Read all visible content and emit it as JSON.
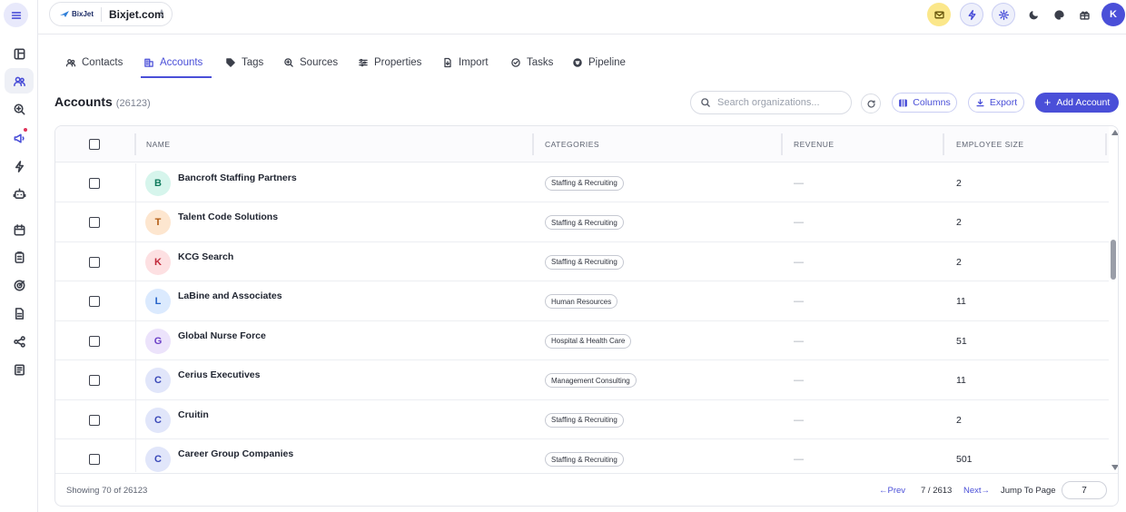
{
  "topbar": {
    "org_logo_text": "BixJet",
    "org_name": "Bixjet.com",
    "avatar_initial": "K"
  },
  "tabs": [
    {
      "label": "Contacts",
      "icon": "users-icon",
      "active": false
    },
    {
      "label": "Accounts",
      "icon": "building-icon",
      "active": true
    },
    {
      "label": "Tags",
      "icon": "tag-icon",
      "active": false
    },
    {
      "label": "Sources",
      "icon": "source-search-icon",
      "active": false
    },
    {
      "label": "Properties",
      "icon": "sliders-icon",
      "active": false
    },
    {
      "label": "Import",
      "icon": "file-import-icon",
      "active": false
    },
    {
      "label": "Tasks",
      "icon": "check-circle-icon",
      "active": false
    },
    {
      "label": "Pipeline",
      "icon": "pipeline-icon",
      "active": false
    }
  ],
  "header": {
    "title": "Accounts",
    "count": "(26123)",
    "search_placeholder": "Search organizations...",
    "columns_label": "Columns",
    "export_label": "Export",
    "add_label": "Add Account"
  },
  "table": {
    "columns": [
      "NAME",
      "CATEGORIES",
      "REVENUE",
      "EMPLOYEE SIZE"
    ],
    "rows": [
      {
        "initial": "B",
        "name": "Bancroft Staffing Partners",
        "category": "Staffing & Recruiting",
        "revenue": "—",
        "employees": "2",
        "avatar_bg": "#d6f5ec",
        "avatar_fg": "#0f7a5c"
      },
      {
        "initial": "T",
        "name": "Talent Code Solutions",
        "category": "Staffing & Recruiting",
        "revenue": "—",
        "employees": "2",
        "avatar_bg": "#fde6cf",
        "avatar_fg": "#b25a10"
      },
      {
        "initial": "K",
        "name": "KCG Search",
        "category": "Staffing & Recruiting",
        "revenue": "—",
        "employees": "2",
        "avatar_bg": "#fde0e2",
        "avatar_fg": "#c0283a"
      },
      {
        "initial": "L",
        "name": "LaBine and Associates",
        "category": "Human Resources",
        "revenue": "—",
        "employees": "11",
        "avatar_bg": "#dbeafe",
        "avatar_fg": "#2563c9"
      },
      {
        "initial": "G",
        "name": "Global Nurse Force",
        "category": "Hospital & Health Care",
        "revenue": "—",
        "employees": "51",
        "avatar_bg": "#ece3fb",
        "avatar_fg": "#6b3fc7"
      },
      {
        "initial": "C",
        "name": "Cerius Executives",
        "category": "Management Consulting",
        "revenue": "—",
        "employees": "11",
        "avatar_bg": "#e1e6fa",
        "avatar_fg": "#3a48b8"
      },
      {
        "initial": "C",
        "name": "Cruitin",
        "category": "Staffing & Recruiting",
        "revenue": "—",
        "employees": "2",
        "avatar_bg": "#e1e6fa",
        "avatar_fg": "#3a48b8"
      },
      {
        "initial": "C",
        "name": "Career Group Companies",
        "category": "Staffing & Recruiting",
        "revenue": "—",
        "employees": "501",
        "avatar_bg": "#e1e6fa",
        "avatar_fg": "#3a48b8"
      }
    ]
  },
  "footer": {
    "showing": "Showing 70 of 26123",
    "prev_label": "←Prev",
    "page_status": "7 / 2613",
    "next_label": "Next→",
    "jump_label": "Jump To Page",
    "jump_value": "7"
  },
  "colors": {
    "accent": "#4a4fd8",
    "mail_button": "#fbe78a"
  }
}
